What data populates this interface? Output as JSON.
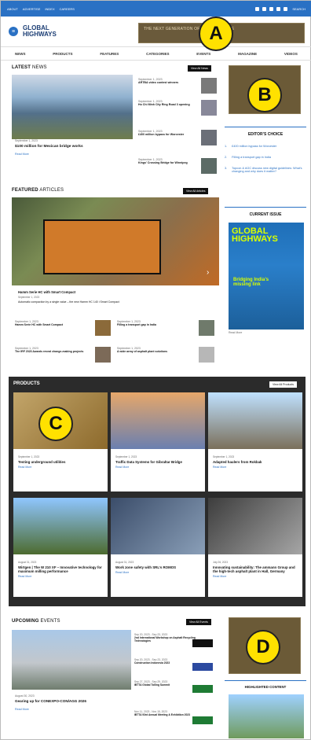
{
  "topbar": {
    "links": [
      "ABOUT",
      "ADVERTISE",
      "INDEX",
      "CAREERS"
    ],
    "search": "SEARCH"
  },
  "header": {
    "logo_text": "GLOBAL\nHIGHWAYS"
  },
  "ad_banner": {
    "text": "THE NEXT GENERATION OF PAVING IS HERE"
  },
  "nav": {
    "items": [
      "NEWS",
      "PRODUCTS",
      "FEATURES",
      "CATEGORIES",
      "EVENTS",
      "MAGAZINE",
      "VIDEOS"
    ]
  },
  "markers": [
    "A",
    "B",
    "C",
    "D"
  ],
  "latest_news": {
    "title_bold": "LATEST",
    "title_light": " NEWS",
    "view_all": "View All News",
    "main": {
      "date": "September 1, 2023",
      "title": "$100 million for Mexican bridge works",
      "read_more": "Read More"
    },
    "items": [
      {
        "date": "September 1, 2023",
        "title": "ARTBA video contest winners"
      },
      {
        "date": "September 1, 2023",
        "title": "Ho Chi Minh City Ring Road 3 opening"
      },
      {
        "date": "September 1, 2023",
        "title": "£400 million bypass for Worcester"
      },
      {
        "date": "September 1, 2023",
        "title": "Kings’ Crossing Bridge for Winnipeg"
      }
    ]
  },
  "sidebar": {
    "editors_choice_title": "EDITOR’S CHOICE",
    "editors_items": [
      {
        "num": "1.",
        "title": "£400 million bypass for Worcester"
      },
      {
        "num": "2.",
        "title": "Filling a transport gap in India"
      },
      {
        "num": "3.",
        "title": "Topcon & AGC discuss new digital guidelines: What’s changing and why does it matter?"
      }
    ],
    "current_issue_title": "CURRENT ISSUE",
    "magazine_title": "GLOBAL\nHIGHWAYS",
    "magazine_subtitle": "Bridging India’s\nmissing link",
    "read_more": "Read More"
  },
  "featured": {
    "title_bold": "FEATURED",
    "title_light": " ARTICLES",
    "view_all": "View All Articles",
    "main_title": "Hamm Serie HC with Smart Compact",
    "main_date": "September 1, 2023",
    "main_desc": "Automatic compaction by a single value – the new Hamm HC 140 i Smart Compact",
    "list": [
      {
        "date": "September 1, 2023",
        "title": "Hamm Serie HC with Smart Compact"
      },
      {
        "date": "September 1, 2023",
        "title": "Filling a transport gap in India"
      },
      {
        "date": "September 1, 2023",
        "title": "The IRF 2023 Awards reveal change-making projects"
      },
      {
        "date": "September 1, 2023",
        "title": "A wide array of asphalt plant solutions"
      }
    ]
  },
  "products": {
    "title": "PRODUCTS",
    "view_all": "View All Products",
    "cards": [
      {
        "date": "September 1, 2023",
        "title": "Testing underground utilities",
        "more": "Read More"
      },
      {
        "date": "September 1, 2023",
        "title": "Traffic Data Systems for Gibraltar Bridge",
        "more": "Read More"
      },
      {
        "date": "September 1, 2023",
        "title": "Adapted haulers from Rokbak",
        "more": "Read More"
      },
      {
        "date": "August 31, 2023",
        "title": "Wirtgen | The W 210 XF – Innovative technology for maximum milling performance",
        "more": "Read More"
      },
      {
        "date": "August 31, 2023",
        "title": "Work zone safety with SRL’s ROMOS",
        "more": "Read More"
      },
      {
        "date": "July 26, 2023",
        "title": "Innovating sustainability: The ammann Group and the high-tech asphalt plant in Hall, Germany",
        "more": "Read More"
      }
    ]
  },
  "events": {
    "title_bold": "UPCOMING",
    "title_light": " EVENTS",
    "view_all": "View All Events",
    "main_date": "August 30, 2023",
    "main_title": "Gearing up for CONEXPO-CON/AGG 2026",
    "main_more": "Read More",
    "items": [
      {
        "date": "Sep 20, 2023 - Sep 23, 2023",
        "title": "2nd International Workshop on Asphalt Recycling Technologies"
      },
      {
        "date": "Sep 20, 2023 - Sep 23, 2023",
        "title": "Construction Indonesia 2023"
      },
      {
        "date": "Sep 27, 2023 - Sep 29, 2023",
        "title": "IBTTA Global Tolling Summit"
      },
      {
        "date": "Nov 11, 2023 - Nov 15, 2023",
        "title": "IBTTA 93rd Annual Meeting & Exhibition 2023"
      }
    ],
    "highlighted_title": "HIGHLIGHTED CONTENT"
  }
}
